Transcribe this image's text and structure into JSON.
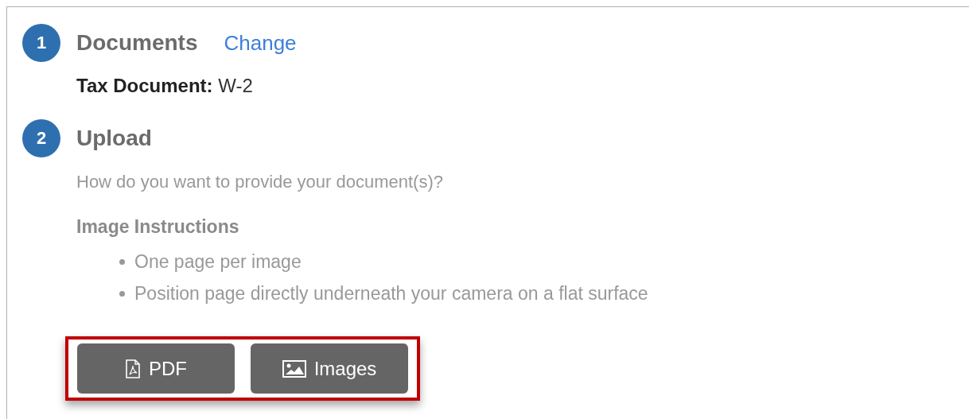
{
  "steps": [
    {
      "number": "1",
      "title": "Documents",
      "link": "Change",
      "detail": "**Tax Document:** W-2"
    },
    {
      "number": "2",
      "title": "Upload",
      "prompt": "How do you want to provide your document(s)?",
      "instructions": {
        "heading": "Image Instructions",
        "items": [
          "One page per image",
          "Position page directly underneath your camera on a flat surface"
        ]
      },
      "buttons": [
        {
          "label": "PDF",
          "kind": "pdf"
        },
        {
          "label": "Images",
          "kind": "image"
        }
      ]
    }
  ]
}
